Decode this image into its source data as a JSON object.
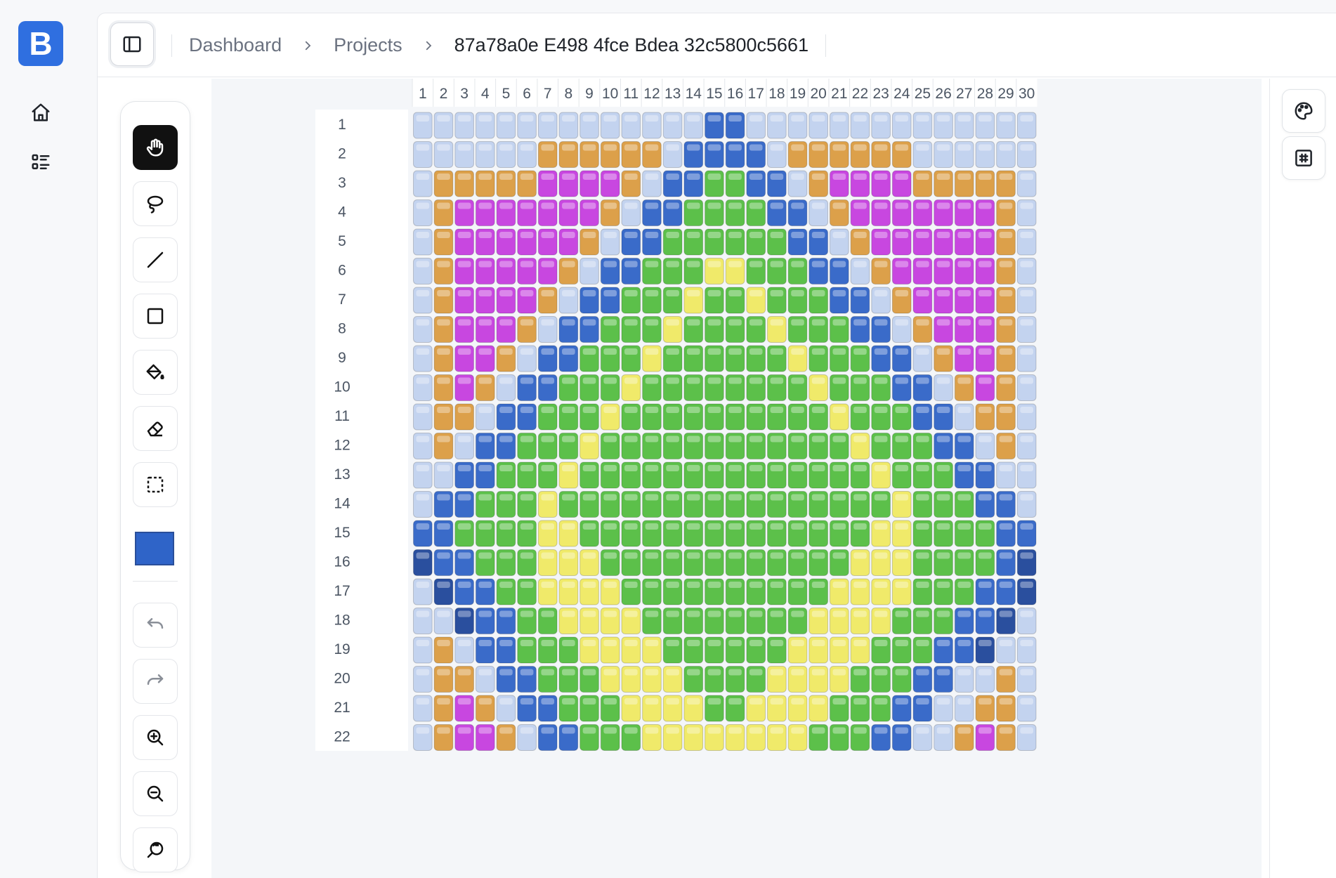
{
  "app": {
    "logo_letter": "B"
  },
  "rail": {
    "items": [
      {
        "icon": "home-icon"
      },
      {
        "icon": "list-icon"
      }
    ]
  },
  "breadcrumb": {
    "items": [
      "Dashboard",
      "Projects",
      "87a78a0e E498 4fce Bdea 32c5800c5661"
    ]
  },
  "toolbar": {
    "tools": [
      "hand-tool",
      "lasso-tool",
      "line-tool",
      "rectangle-tool",
      "fill-tool",
      "eraser-tool",
      "select-tool"
    ],
    "active_tool": "hand-tool",
    "current_color": "#2f64c8",
    "history": [
      "undo",
      "redo"
    ],
    "zoom": [
      "zoom-in",
      "zoom-out",
      "zoom-reset"
    ]
  },
  "right_panel": {
    "buttons": [
      "palette-button",
      "grid-button"
    ]
  },
  "grid": {
    "columns": [
      "1",
      "2",
      "3",
      "4",
      "5",
      "6",
      "7",
      "8",
      "9",
      "10",
      "11",
      "12",
      "13",
      "14",
      "15",
      "16",
      "17",
      "18",
      "19",
      "20",
      "21",
      "22",
      "23",
      "24",
      "25",
      "26",
      "27",
      "28",
      "29",
      "30"
    ],
    "rows": [
      "1",
      "2",
      "3",
      "4",
      "5",
      "6",
      "7",
      "8",
      "9",
      "10",
      "11",
      "12",
      "13",
      "14",
      "15",
      "16",
      "17",
      "18",
      "19",
      "20",
      "21",
      "22"
    ],
    "palette": {
      "L": "#c3d3ef",
      "B": "#3a6bc9",
      "D": "#2a4f9e",
      "O": "#dca04a",
      "M": "#c847e0",
      "G": "#5cc04a",
      "Y": "#f0ea6a"
    },
    "cells": [
      "LLLLLLLLLLLLLLBBLLLLLLLLLLLLLL",
      "LLLLLLOOOOOOLBBBBLOOOOOOLLLLLL",
      "LOOOOOMMMMOLBBGGBBLOMMMMOOOOOL",
      "LOMMMMMMMOLBBGGGGBBLOMMMMMMMOL",
      "LOMMMMMMOLBBGGGGGGBBLOMMMMMMOL",
      "LOMMMMMOLBBGGGYYGGGBBLOMMMMMOL",
      "LOMMMMOLBBGGGYGGYGGGBBLOMMMMOL",
      "LOMMMOLBBGGGYGGGGYGGGBBLOMMMOL",
      "LOMMOLBBGGGYGGGGGGYGGGBBLOMMOL",
      "LOMOLBBGGGYGGGGGGGGYGGGBBLOMOL",
      "LOOLBBGGGYGGGGGGGGGGYGGGBBLOOL",
      "LOLBBGGGYGGGGGGGGGGGGYGGGBBLOL",
      "LLBBGGGYGGGGGGGGGGGGGGYGGGBBLL",
      "LBBGGGYGGGGGGGGGGGGGGGGYGGGBBL",
      "BBGGGGYYGGGGGGGGGGGGGGYYGGGGBB",
      "DBBGGGYYYGGGGGGGGGGGGYYYGGGGBD",
      "LDBBGGYYYYGGGGGGGGGGYYYYGGGBBD",
      "LLDBBGGYYYYGGGGGGGGYYYYGGGBBDL",
      "LOLBBGGGYYYYGGGGGGYYYYGGGBBDLL",
      "LOOLBBGGGYYYYGGGGYYYYGGGBBLLOL",
      "LOMOLBBGGGYYYYGGYYYYGGGBBLLOOL",
      "LOMMOLBBGGGYYYYYYYYGGGBBLLOMOL"
    ]
  }
}
